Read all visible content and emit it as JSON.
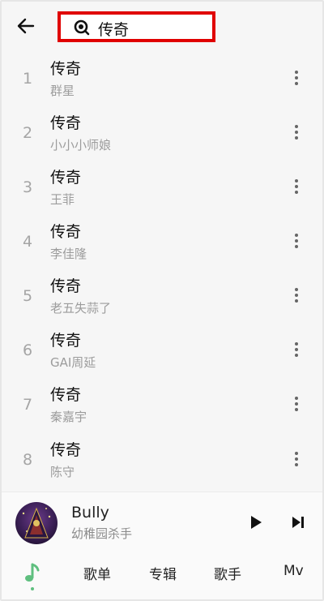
{
  "search": {
    "query": "传奇"
  },
  "songs": [
    {
      "num": "1",
      "title": "传奇",
      "artist": "群星"
    },
    {
      "num": "2",
      "title": "传奇",
      "artist": "小小小师娘"
    },
    {
      "num": "3",
      "title": "传奇",
      "artist": "王菲"
    },
    {
      "num": "4",
      "title": "传奇",
      "artist": "李佳隆"
    },
    {
      "num": "5",
      "title": "传奇",
      "artist": "老五失蒜了"
    },
    {
      "num": "6",
      "title": "传奇",
      "artist": "GAI周延"
    },
    {
      "num": "7",
      "title": "传奇",
      "artist": "秦嘉宇"
    },
    {
      "num": "8",
      "title": "传奇",
      "artist": "陈守"
    }
  ],
  "player": {
    "title": "Bully",
    "artist": "幼稚园杀手"
  },
  "tabs": {
    "songs": "歌单",
    "albums": "专辑",
    "artists": "歌手",
    "mv": "Mv"
  },
  "colors": {
    "accent": "#5fbf7f",
    "highlight_border": "#e00000"
  }
}
